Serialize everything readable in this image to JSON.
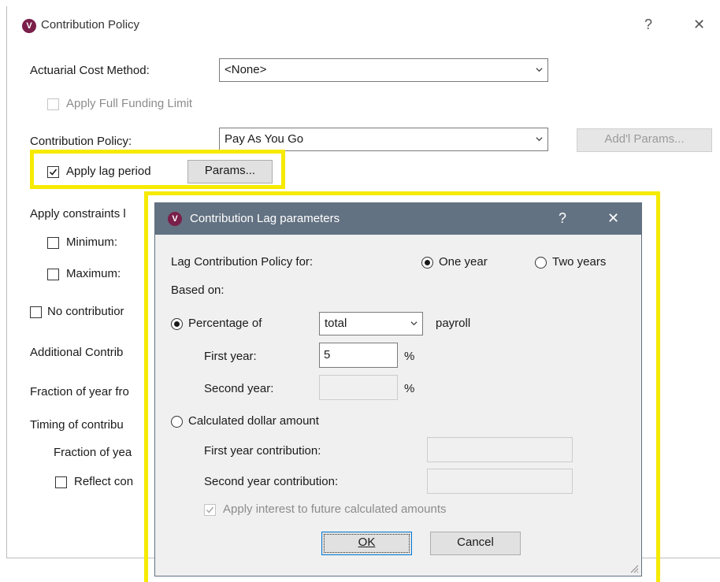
{
  "window": {
    "title": "Contribution Policy",
    "help": "?",
    "close": "✕",
    "actuarial_label": "Actuarial Cost Method:",
    "actuarial_value": "<None>",
    "full_funding": "Apply Full Funding Limit",
    "policy_label": "Contribution Policy:",
    "policy_value": "Pay As You Go",
    "addl_params": "Add'l Params...",
    "apply_lag": "Apply lag period",
    "params_button": "Params...",
    "constraints": "Apply constraints l",
    "minimum": "Minimum:",
    "maximum": "Maximum:",
    "no_contribution": "No contributior",
    "additional": "Additional Contrib",
    "fraction": "Fraction of year fro",
    "timing": "Timing of contribu",
    "fraction_year": "Fraction of yea",
    "reflect": "Reflect con"
  },
  "dialog": {
    "title": "Contribution Lag parameters",
    "help": "?",
    "close": "✕",
    "lag_for": "Lag Contribution Policy for:",
    "one_year": "One year",
    "two_years": "Two years",
    "based_on": "Based on:",
    "percentage_of": "Percentage of",
    "payroll_value": "total",
    "payroll": "payroll",
    "first_year": "First year:",
    "first_year_value": "5",
    "pct1": "%",
    "second_year": "Second year:",
    "pct2": "%",
    "calculated": "Calculated dollar amount",
    "first_contrib": "First year contribution:",
    "second_contrib": "Second year contribution:",
    "apply_interest": "Apply interest to future calculated amounts",
    "ok": "OK",
    "cancel": "Cancel"
  },
  "colors": {
    "highlight": "#f6ea00",
    "dialog_title_bar": "#637282",
    "app_icon": "#7a1f4a"
  }
}
